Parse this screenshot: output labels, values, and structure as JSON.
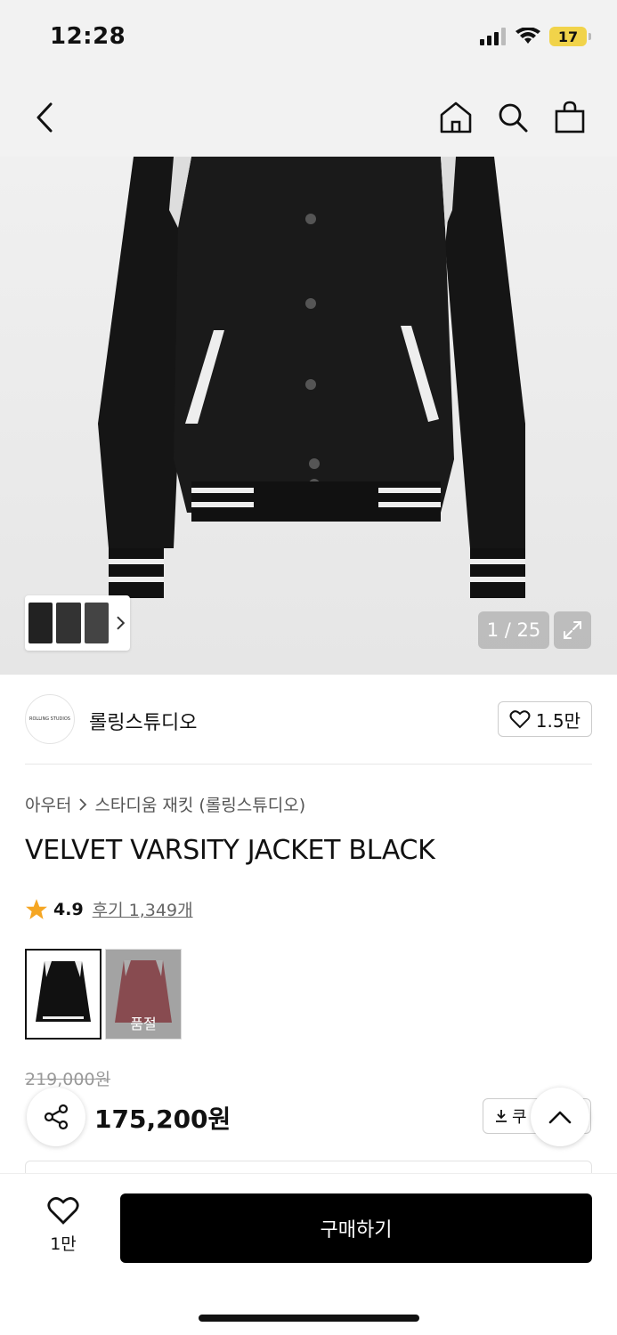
{
  "status": {
    "time": "12:28",
    "battery": "17",
    "colors": {
      "battery": "#f1d34a"
    }
  },
  "nav": {
    "icons": [
      "back-icon",
      "home-icon",
      "search-icon",
      "bag-icon"
    ]
  },
  "gallery": {
    "counter": "1 / 25",
    "thumb_icons": [
      "chevron-right-icon"
    ],
    "expand_icon": "expand-icon"
  },
  "brand": {
    "logo_text": "ROLLING STUDIOS",
    "name": "롤링스튜디오",
    "likes": "1.5만"
  },
  "product": {
    "breadcrumb": [
      "아우터",
      "스타디움 재킷 (롤링스튜디오)"
    ],
    "title": "VELVET VARSITY JACKET BLACK",
    "rating": "4.9",
    "reviews": "후기 1,349개",
    "swatches": [
      {
        "color": "black",
        "sold_out": ""
      },
      {
        "color": "red",
        "sold_out": "품절"
      }
    ],
    "original_price": "219,000원",
    "sale_price": "175,200원",
    "coupon": "쿠"
  },
  "bottom": {
    "wish_count": "1만",
    "buy_label": "구매하기"
  },
  "colors": {
    "accent_star": "#f5a623",
    "buy_button": "#000000"
  }
}
